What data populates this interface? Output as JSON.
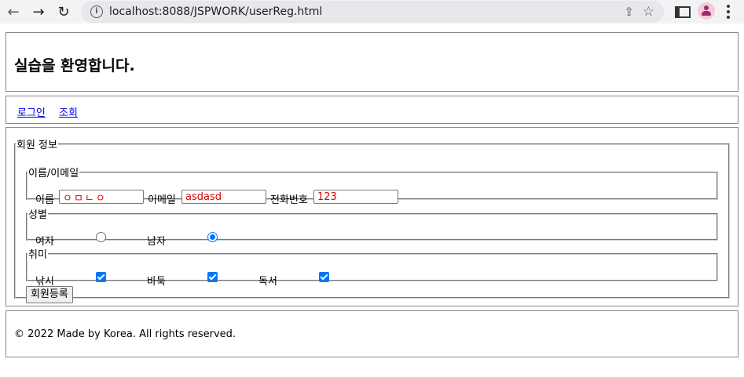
{
  "browser": {
    "url": "localhost:8088/JSPWORK/userReg.html",
    "back_glyph": "←",
    "forward_glyph": "→",
    "reload_glyph": "↻",
    "info_glyph": "i",
    "share_glyph": "⇪",
    "star_glyph": "☆"
  },
  "header": {
    "title": "실습을 환영합니다."
  },
  "nav": {
    "login": "로그인",
    "view": "조회"
  },
  "form": {
    "legend": "회원 정보",
    "name_email": {
      "legend": "이름/이메일",
      "name_label": "이름",
      "name_value": "ㅇㅁㄴㅇ",
      "email_label": "이메일",
      "email_value": "asdasd",
      "phone_label": "전화번호",
      "phone_value": "123"
    },
    "gender": {
      "legend": "성별",
      "female": "여자",
      "male": "남자",
      "selected": "남자"
    },
    "hobby": {
      "legend": "취미",
      "fishing": "낚시",
      "baduk": "바둑",
      "reading": "독서",
      "checked": [
        "낚시",
        "바둑",
        "독서"
      ]
    },
    "submit": "회원등록"
  },
  "footer": {
    "text": "© 2022 Made by Korea. All rights reserved."
  },
  "colors": {
    "accent": "#0075ff",
    "input_text": "#e00000",
    "link": "#0000ee"
  }
}
